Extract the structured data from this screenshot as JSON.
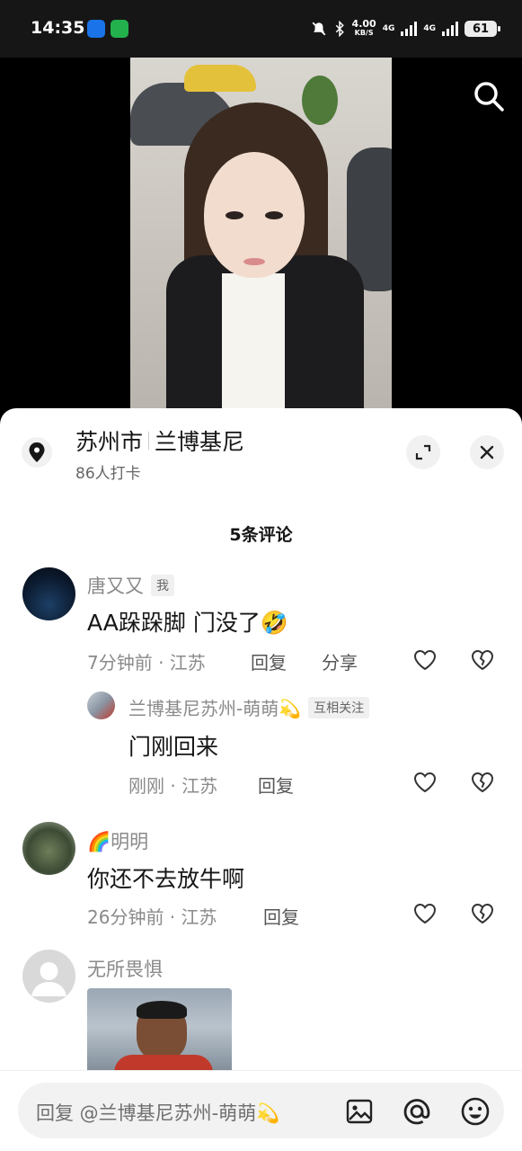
{
  "status_bar": {
    "time": "14:35",
    "net_speed_value": "4.00",
    "net_speed_unit": "KB/S",
    "network_1": "4G",
    "network_2": "4G",
    "battery": "61"
  },
  "location": {
    "city": "苏州市",
    "place": "兰博基尼",
    "checkins": "86人打卡"
  },
  "comments_header": "5条评论",
  "comments": [
    {
      "user": "唐又又",
      "badge": "我",
      "text": "AA跺跺脚 门没了🤣",
      "meta": "7分钟前 · 江苏",
      "reply_label": "回复",
      "share_label": "分享",
      "replies": [
        {
          "user": "兰博基尼苏州-萌萌💫",
          "badge": "互相关注",
          "text": "门刚回来",
          "meta": "刚刚 · 江苏",
          "reply_label": "回复"
        }
      ]
    },
    {
      "user": "🌈明明",
      "text": "你还不去放牛啊",
      "meta": "26分钟前 · 江苏",
      "reply_label": "回复"
    },
    {
      "user": "无所畏惧"
    }
  ],
  "input": {
    "placeholder": "回复 @兰博基尼苏州-萌萌💫"
  },
  "icons": {
    "search": "search-icon",
    "location": "location-pin-icon",
    "expand": "expand-icon",
    "close": "close-icon",
    "like": "heart-icon",
    "dislike": "broken-heart-icon",
    "image": "image-icon",
    "mention": "at-icon",
    "emoji": "emoji-icon"
  }
}
